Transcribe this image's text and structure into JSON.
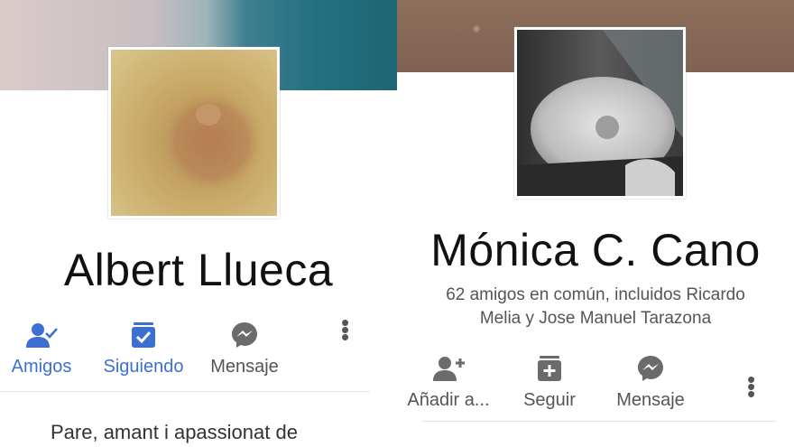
{
  "left_profile": {
    "name": "Albert Llueca",
    "actions": {
      "friends_label": "Amigos",
      "following_label": "Siguiendo",
      "message_label": "Mensaje"
    },
    "bio": "Pare, amant i  apassionat de"
  },
  "right_profile": {
    "name": "Mónica C. Cano",
    "mutual_line1": "62 amigos en común, incluidos Ricardo",
    "mutual_line2": "Melia y Jose Manuel Tarazona",
    "actions": {
      "add_friend_label": "Añadir a...",
      "follow_label": "Seguir",
      "message_label": "Mensaje"
    }
  },
  "colors": {
    "accent_blue": "#3b6fd4",
    "icon_grey": "#6b6b6b"
  }
}
